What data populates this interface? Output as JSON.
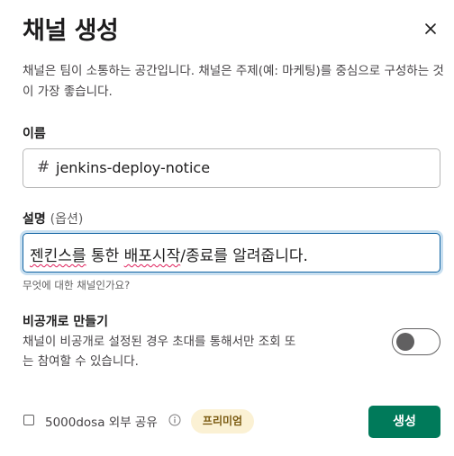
{
  "dialog": {
    "title": "채널 생성",
    "intro": "채널은 팀이 소통하는 공간입니다. 채널은 주제(예: 마케팅)를 중심으로 구성하는 것이 가장 좋습니다."
  },
  "name_field": {
    "label": "이름",
    "prefix": "#",
    "value": "jenkins-deploy-notice"
  },
  "description_field": {
    "label": "설명",
    "optional": "(옵션)",
    "value_part1": "젠킨스를",
    "value_part2": " 통한 ",
    "value_part3": "배포시작",
    "value_part4": "/종료를 알려줍니다.",
    "hint": "무엇에 대한 채널인가요?"
  },
  "private": {
    "title": "비공개로 만들기",
    "description": "채널이 비공개로 설정된 경우 초대를 통해서만 조회 또는 참여할 수 있습니다.",
    "enabled": false
  },
  "external_share": {
    "label": "5000dosa 외부 공유",
    "checked": false,
    "badge": "프리미엄"
  },
  "actions": {
    "create_label": "생성"
  },
  "icons": [
    "close-icon",
    "info-icon"
  ],
  "colors": {
    "primary_button": "#007a5a",
    "focus_border": "#1264a3",
    "premium_badge_bg": "#fbf1d4"
  }
}
